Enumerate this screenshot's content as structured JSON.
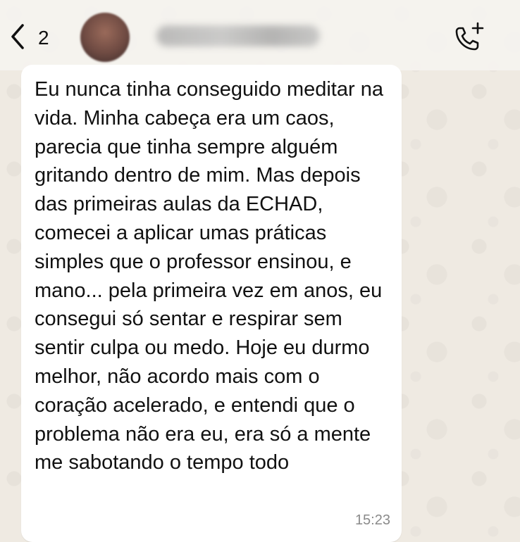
{
  "header": {
    "back_count": "2",
    "back_icon": "chevron-left-icon",
    "call_icon": "phone-plus-icon"
  },
  "message": {
    "text": "Eu nunca tinha conseguido meditar na vida. Minha cabeça era um caos, parecia que tinha sempre alguém gritando dentro de mim. Mas depois das primeiras aulas da ECHAD, comecei a aplicar umas práticas simples que o professor ensinou, e mano... pela primeira vez em anos, eu consegui só sentar e respirar sem sentir culpa ou medo. Hoje eu durmo melhor, não acordo mais com o coração acelerado, e entendi que o problema não era eu, era só a mente me sabotando o tempo todo",
    "time": "15:23"
  },
  "colors": {
    "background": "#efeae2",
    "bubble": "#ffffff",
    "text": "#111111",
    "timestamp": "#8a8a8a"
  }
}
